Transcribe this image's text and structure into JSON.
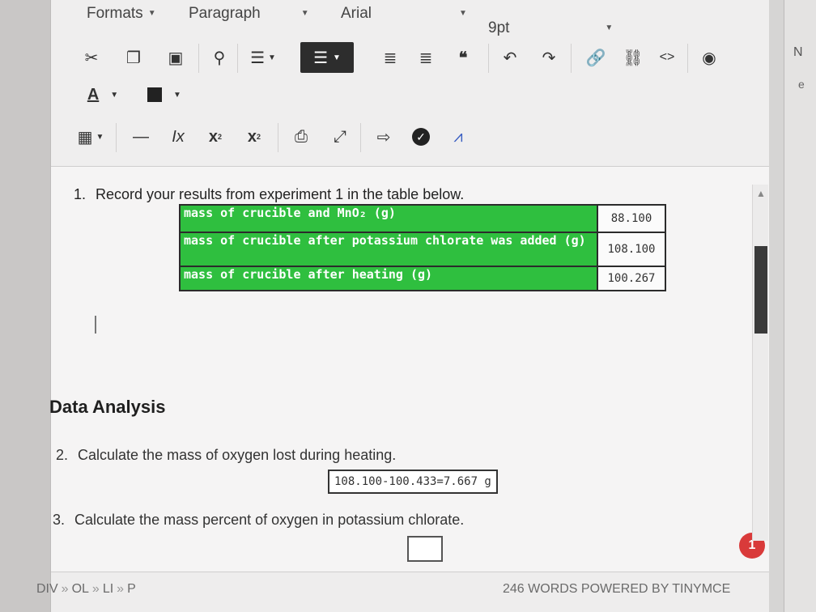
{
  "menu": {
    "formats": "Formats",
    "paragraph": "Paragraph",
    "font": "Arial",
    "size": "9pt"
  },
  "toolbar": {
    "row2_icons": [
      "cut-icon",
      "copy-icon",
      "paste-icon",
      "find-icon",
      "bullet-list-icon",
      "numbered-list-icon",
      "align-left-icon",
      "align-right-icon",
      "blockquote-icon",
      "undo-icon",
      "redo-icon",
      "link-icon",
      "unlink-icon",
      "code-icon",
      "preview-icon"
    ],
    "row3": {
      "text_color_label": "A"
    },
    "row4_icons": [
      "table-icon",
      "horizontal-rule-icon",
      "clear-format-icon",
      "subscript-icon",
      "superscript-icon",
      "print-icon",
      "fullscreen-icon",
      "share-icon",
      "check-icon",
      "chart-icon"
    ],
    "clear_format_label": "Ix",
    "subscript_label": "x",
    "superscript_label": "x"
  },
  "content": {
    "q1": {
      "num": "1.",
      "text": "Record your results from experiment 1 in the table below."
    },
    "table": [
      {
        "label": "mass of crucible and MnO₂ (g)",
        "value": "88.100"
      },
      {
        "label": "mass of crucible after potassium chlorate was added (g)",
        "value": "108.100"
      },
      {
        "label": "mass of crucible after heating (g)",
        "value": "100.267"
      }
    ],
    "heading": "Data Analysis",
    "q2": {
      "num": "2.",
      "text": "Calculate the mass of oxygen lost during heating.",
      "answer": "108.100-100.433=7.667 g"
    },
    "q3": {
      "num": "3.",
      "text": "Calculate the mass percent of oxygen in potassium chlorate.",
      "answer": ""
    },
    "badge": "1"
  },
  "status": {
    "path": [
      "DIV",
      "OL",
      "LI",
      "P"
    ],
    "path_separator": "»",
    "words": "246 WORDS POWERED BY TINYMCE"
  },
  "side": {
    "t1": "N",
    "t2": "e"
  },
  "colors": {
    "table_label_bg": "#2fbf3f",
    "badge": "#d93a3a"
  }
}
